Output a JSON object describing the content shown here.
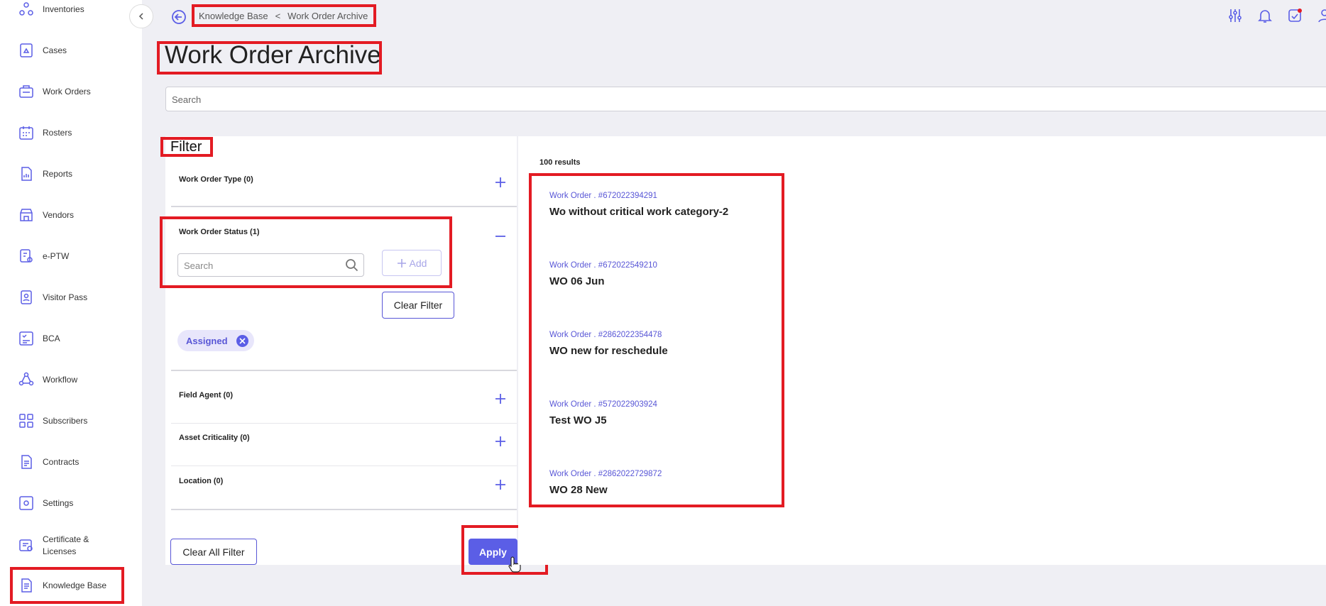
{
  "sidebar": {
    "items": [
      {
        "label": "Inventories",
        "icon": "inventories-icon"
      },
      {
        "label": "Cases",
        "icon": "cases-icon"
      },
      {
        "label": "Work Orders",
        "icon": "work-orders-icon"
      },
      {
        "label": "Rosters",
        "icon": "rosters-icon"
      },
      {
        "label": "Reports",
        "icon": "reports-icon"
      },
      {
        "label": "Vendors",
        "icon": "vendors-icon"
      },
      {
        "label": "e-PTW",
        "icon": "eptw-icon"
      },
      {
        "label": "Visitor Pass",
        "icon": "visitor-pass-icon"
      },
      {
        "label": "BCA",
        "icon": "bca-icon"
      },
      {
        "label": "Workflow",
        "icon": "workflow-icon"
      },
      {
        "label": "Subscribers",
        "icon": "subscribers-icon"
      },
      {
        "label": "Contracts",
        "icon": "contracts-icon"
      },
      {
        "label": "Settings",
        "icon": "settings-icon"
      },
      {
        "label": "Certificate & Licenses",
        "icon": "certificate-icon"
      },
      {
        "label": "Knowledge Base",
        "icon": "knowledge-base-icon"
      }
    ]
  },
  "breadcrumb": {
    "parent": "Knowledge Base",
    "separator": "<",
    "current": "Work Order Archive"
  },
  "page": {
    "title": "Work Order Archive",
    "search_placeholder": "Search"
  },
  "filter": {
    "title": "Filter",
    "sections": {
      "work_order_type": "Work Order Type  (0)",
      "work_order_status": "Work Order Status  (1)",
      "field_agent": "Field Agent  (0)",
      "asset_criticality": "Asset Criticality  (0)",
      "location": "Location  (0)"
    },
    "status_search_placeholder": "Search",
    "add_label": "Add",
    "clear_filter_label": "Clear Filter",
    "selected_chip": "Assigned",
    "clear_all_label": "Clear All Filter",
    "apply_label": "Apply"
  },
  "results": {
    "count": "100 results",
    "items": [
      {
        "id": "Work Order . #672022394291",
        "title": "Wo without critical work category-2"
      },
      {
        "id": "Work Order . #672022549210",
        "title": "WO 06 Jun"
      },
      {
        "id": "Work Order . #2862022354478",
        "title": "WO new for reschedule"
      },
      {
        "id": "Work Order . #572022903924",
        "title": "Test WO J5"
      },
      {
        "id": "Work Order . #2862022729872",
        "title": "WO 28 New"
      }
    ]
  },
  "colors": {
    "accent": "#5b5ee6",
    "highlight": "#e31b23",
    "background": "#efeff4"
  }
}
